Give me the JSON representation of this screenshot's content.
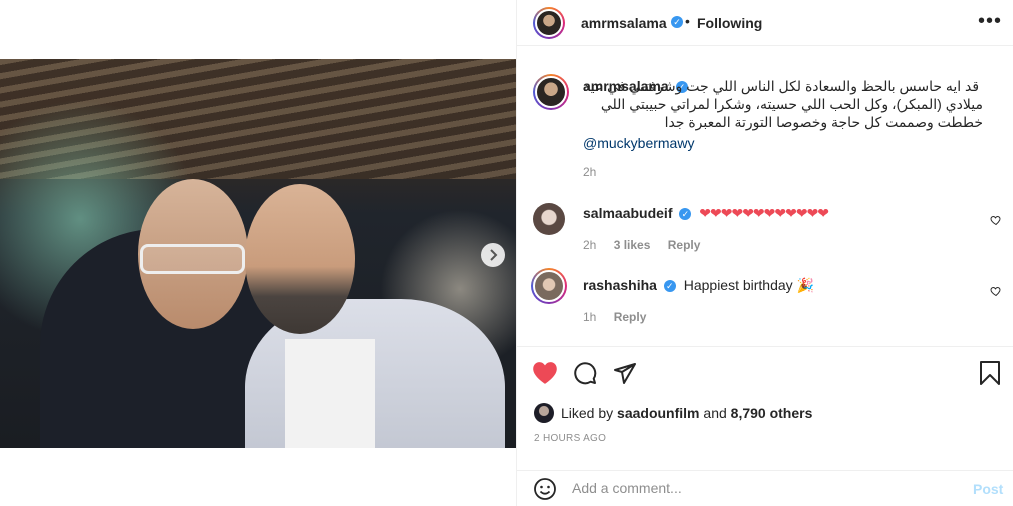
{
  "post": {
    "author": "amrmsalama",
    "follow_status": "Following",
    "more_glyph": "•••",
    "separator": "•"
  },
  "caption": {
    "username": "amrmsalama",
    "text": "قد ايه حاسس بالحظ والسعادة لكل الناس اللي جت وشرفتني في عيد ميلادي (المبكر)، وكل الحب اللي حسيته، وشكرا لمراتي حبيبتي اللي خططت وصممت كل حاجة وخصوصا التورتة المعبرة جدا",
    "mention": "@muckybermawy",
    "time": "2h"
  },
  "comments": [
    {
      "username": "salmaabudeif",
      "text": "❤❤❤❤❤❤❤❤❤❤❤❤",
      "time": "2h",
      "likes": "3 likes",
      "reply": "Reply"
    },
    {
      "username": "rashashiha",
      "text": "Happiest birthday 🎉",
      "time": "1h",
      "reply": "Reply"
    }
  ],
  "likes": {
    "prefix": "Liked by",
    "user": "saadounfilm",
    "conjunction": "and",
    "others": "8,790 others"
  },
  "timestamp": "2 HOURS AGO",
  "add_comment": {
    "placeholder": "Add a comment...",
    "post_label": "Post"
  },
  "colors": {
    "like_red": "#ed4956",
    "verified_blue": "#3897f0",
    "link_blue": "#00376b",
    "post_disabled": "#b2dffc"
  },
  "icons": {
    "like": "heart-icon",
    "comment": "comment-icon",
    "share": "paper-plane-icon",
    "save": "bookmark-icon",
    "emoji": "smiley-icon",
    "next": "chevron-right-icon"
  }
}
